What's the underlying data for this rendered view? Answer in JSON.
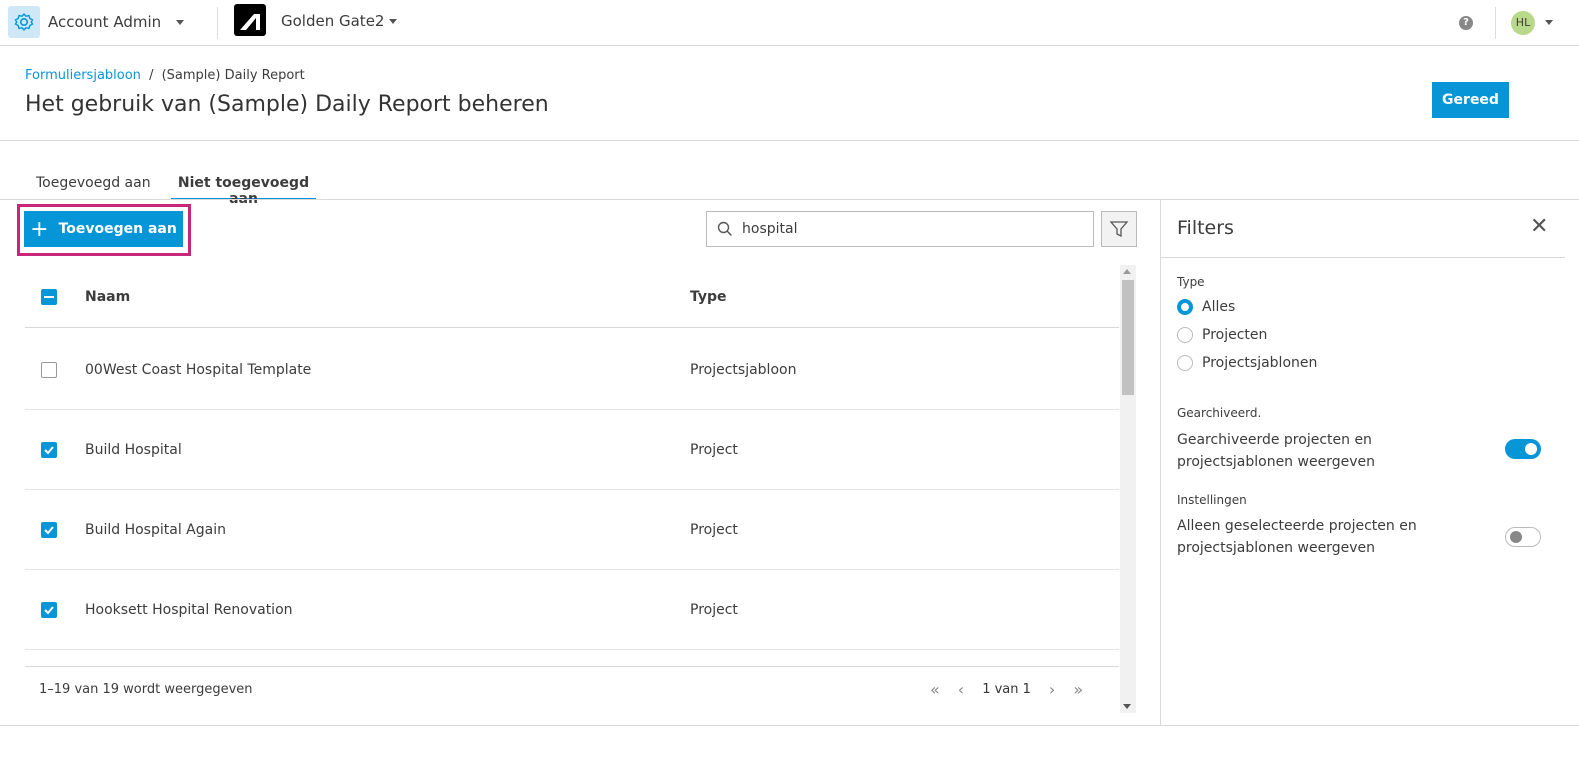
{
  "topbar": {
    "account": "Account Admin",
    "project": "Golden Gate2",
    "avatar": "HL"
  },
  "header": {
    "breadcrumb_link": "Formuliersjabloon",
    "breadcrumb_sep": "/",
    "breadcrumb_current": "(Sample) Daily Report",
    "title": "Het gebruik van (Sample) Daily Report beheren",
    "done_label": "Gereed"
  },
  "tabs": [
    {
      "label": "Toegevoegd aan",
      "active": false
    },
    {
      "label": "Niet toegevoegd aan",
      "active": true
    }
  ],
  "toolbar": {
    "add_label": "Toevoegen aan",
    "search_value": "hospital"
  },
  "table": {
    "columns": [
      "Naam",
      "Type"
    ],
    "rows": [
      {
        "name": "00West Coast Hospital Template",
        "type": "Projectsjabloon",
        "checked": false
      },
      {
        "name": "Build Hospital",
        "type": "Project",
        "checked": true
      },
      {
        "name": "Build Hospital Again",
        "type": "Project",
        "checked": true
      },
      {
        "name": "Hooksett Hospital Renovation",
        "type": "Project",
        "checked": true
      }
    ]
  },
  "footer": {
    "count": "1–19 van 19 wordt weergegeven",
    "page": "1 van 1"
  },
  "filters": {
    "title": "Filters",
    "type_label": "Type",
    "type_options": [
      "Alles",
      "Projecten",
      "Projectsjablonen"
    ],
    "archived_label": "Gearchiveerd.",
    "archived_text": "Gearchiveerde projecten en projectsjablonen weergeven",
    "archived_on": true,
    "settings_label": "Instellingen",
    "settings_text": "Alleen geselecteerde projecten en projectsjablonen weergeven",
    "settings_on": false
  },
  "colors": {
    "accent": "#0696d7",
    "highlight": "#c8267a"
  }
}
